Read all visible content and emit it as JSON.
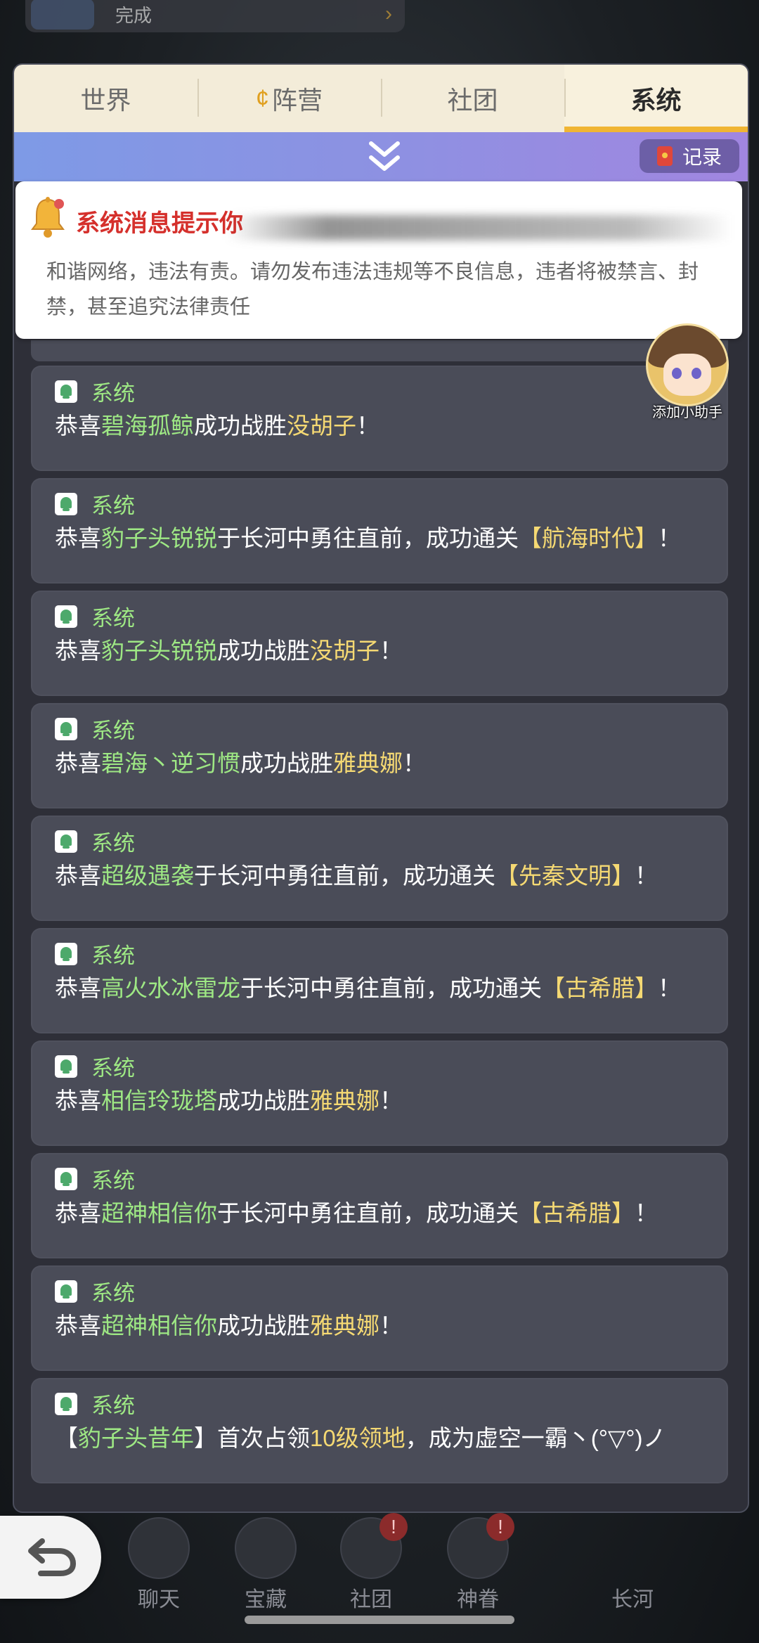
{
  "top_banner": {
    "text": "完成"
  },
  "tabs": [
    {
      "label": "世界"
    },
    {
      "label": "阵营",
      "icon": "camp-icon"
    },
    {
      "label": "社团"
    },
    {
      "label": "系统",
      "active": true
    }
  ],
  "record_button": {
    "label": "记录"
  },
  "notice": {
    "title": "系统消息提示你",
    "body": "和谐网络，违法有责。请勿发布违法违规等不良信息，违者将被禁言、封禁，甚至追究法律责任"
  },
  "helper": {
    "label": "添加小助手"
  },
  "messages": [
    {
      "sender": "系统",
      "parts": [
        {
          "t": "恭喜",
          "c": "w"
        },
        {
          "t": "碧海孤鲸",
          "c": "g"
        },
        {
          "t": "成功战胜",
          "c": "w"
        },
        {
          "t": "没胡子",
          "c": "y"
        },
        {
          "t": "！",
          "c": "w"
        }
      ]
    },
    {
      "sender": "系统",
      "parts": [
        {
          "t": "恭喜",
          "c": "w"
        },
        {
          "t": "豹子头锐锐",
          "c": "g"
        },
        {
          "t": "于长河中勇往直前，成功通关",
          "c": "w"
        },
        {
          "t": "【航海时代】",
          "c": "y"
        },
        {
          "t": "！",
          "c": "w"
        }
      ]
    },
    {
      "sender": "系统",
      "parts": [
        {
          "t": "恭喜",
          "c": "w"
        },
        {
          "t": "豹子头锐锐",
          "c": "g"
        },
        {
          "t": "成功战胜",
          "c": "w"
        },
        {
          "t": "没胡子",
          "c": "y"
        },
        {
          "t": "！",
          "c": "w"
        }
      ]
    },
    {
      "sender": "系统",
      "parts": [
        {
          "t": "恭喜",
          "c": "w"
        },
        {
          "t": "碧海丶逆习惯",
          "c": "g"
        },
        {
          "t": "成功战胜",
          "c": "w"
        },
        {
          "t": "雅典娜",
          "c": "y"
        },
        {
          "t": "！",
          "c": "w"
        }
      ]
    },
    {
      "sender": "系统",
      "parts": [
        {
          "t": "恭喜",
          "c": "w"
        },
        {
          "t": "超级遇袭",
          "c": "g"
        },
        {
          "t": "于长河中勇往直前，成功通关",
          "c": "w"
        },
        {
          "t": "【先秦文明】",
          "c": "y"
        },
        {
          "t": "！",
          "c": "w"
        }
      ]
    },
    {
      "sender": "系统",
      "parts": [
        {
          "t": "恭喜",
          "c": "w"
        },
        {
          "t": "高火水冰雷龙",
          "c": "g"
        },
        {
          "t": "于长河中勇往直前，成功通关",
          "c": "w"
        },
        {
          "t": "【古希腊】",
          "c": "y"
        },
        {
          "t": "！",
          "c": "w"
        }
      ]
    },
    {
      "sender": "系统",
      "parts": [
        {
          "t": "恭喜",
          "c": "w"
        },
        {
          "t": "相信玲珑塔",
          "c": "g"
        },
        {
          "t": "成功战胜",
          "c": "w"
        },
        {
          "t": "雅典娜",
          "c": "y"
        },
        {
          "t": "！",
          "c": "w"
        }
      ]
    },
    {
      "sender": "系统",
      "parts": [
        {
          "t": "恭喜",
          "c": "w"
        },
        {
          "t": "超神相信你",
          "c": "g"
        },
        {
          "t": "于长河中勇往直前，成功通关",
          "c": "w"
        },
        {
          "t": "【古希腊】",
          "c": "y"
        },
        {
          "t": "！",
          "c": "w"
        }
      ]
    },
    {
      "sender": "系统",
      "parts": [
        {
          "t": "恭喜",
          "c": "w"
        },
        {
          "t": "超神相信你",
          "c": "g"
        },
        {
          "t": "成功战胜",
          "c": "w"
        },
        {
          "t": "雅典娜",
          "c": "y"
        },
        {
          "t": "！",
          "c": "w"
        }
      ]
    },
    {
      "sender": "系统",
      "parts": [
        {
          "t": "【",
          "c": "w"
        },
        {
          "t": "豹子头昔年",
          "c": "g"
        },
        {
          "t": "】首次占领",
          "c": "w"
        },
        {
          "t": "10级领地",
          "c": "y"
        },
        {
          "t": "，成为虚空一霸丶(°▽°)ノ",
          "c": "w"
        }
      ]
    }
  ],
  "bottom_nav": [
    {
      "label": "聊天",
      "icon": "chat-icon"
    },
    {
      "label": "宝藏",
      "icon": "treasure-icon"
    },
    {
      "label": "社团",
      "icon": "club-icon",
      "badge": "!"
    },
    {
      "label": "神眷",
      "icon": "star-icon",
      "badge": "!"
    },
    {
      "label": "长河",
      "icon": "river-icon"
    }
  ],
  "colors": {
    "green": "#9ee884",
    "yellow": "#f5d973",
    "tab_active": "#f0b533",
    "notice_title": "#d5302c"
  }
}
